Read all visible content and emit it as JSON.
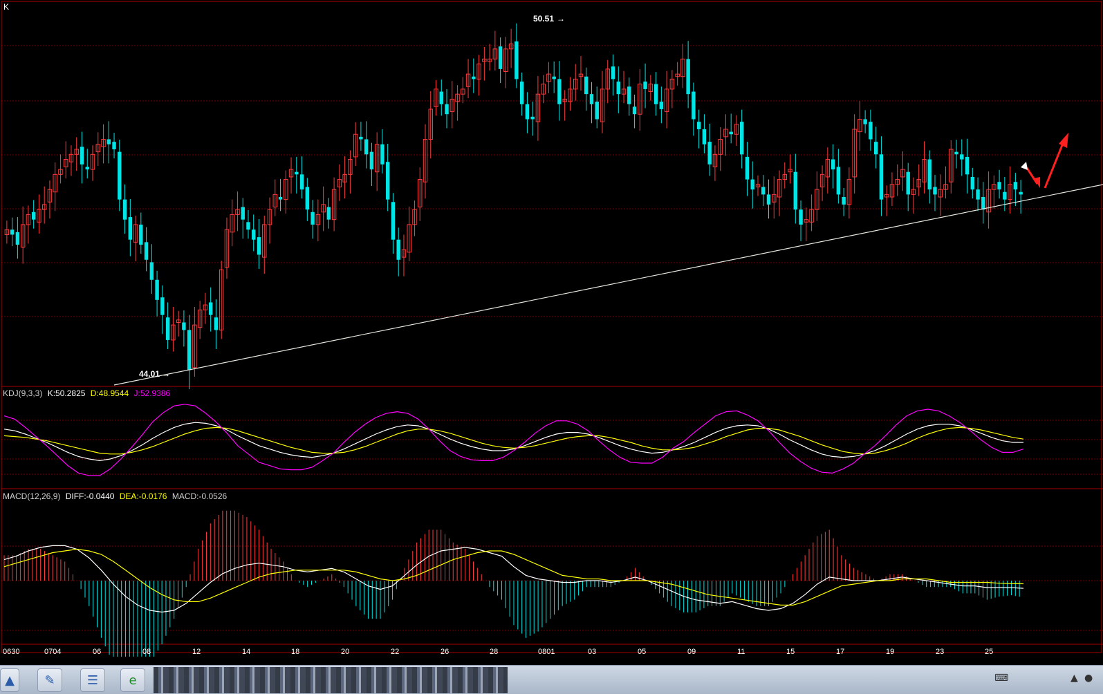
{
  "panel_label": "K",
  "kdj_label": {
    "name": "KDJ(9,3,3)",
    "k": "K:50.2825",
    "d": "D:48.9544",
    "j": "J:52.9386"
  },
  "macd_label": {
    "name": "MACD(12,26,9)",
    "diff": "DIFF:-0.0440",
    "dea": "DEA:-0.0176",
    "macd": "MACD:-0.0526"
  },
  "colors": {
    "up": "#ff3b3b",
    "down": "#00e5e5",
    "gridline": "#7a0000",
    "k_line": "#ffffff",
    "d_line": "#ffff00",
    "j_line": "#ff00ff",
    "panel_border": "#aa0000",
    "annotation_arrow": "#ff2020"
  },
  "chart_data": {
    "type": "candlestick",
    "annotations": {
      "high_label": "50.51",
      "low_label": "44.01",
      "trendline": "rising support line from 44.01 low",
      "arrows": "down then up (red)"
    },
    "ylim": [
      43.8,
      51.1
    ],
    "x_tick_labels": [
      "0630",
      "0704",
      "06",
      "08",
      "12",
      "14",
      "18",
      "20",
      "22",
      "26",
      "28",
      "0801",
      "03",
      "05",
      "09",
      "11",
      "15",
      "17",
      "19",
      "23",
      "25"
    ],
    "closes": [
      46.8,
      46.7,
      46.5,
      46.9,
      47.1,
      47.0,
      47.2,
      47.3,
      47.6,
      47.9,
      48.0,
      48.2,
      48.3,
      48.4,
      48.1,
      48.0,
      48.3,
      48.5,
      48.6,
      48.5,
      48.4,
      47.4,
      47.0,
      46.6,
      46.9,
      46.5,
      46.2,
      45.8,
      45.4,
      45.1,
      44.6,
      44.9,
      45.0,
      44.8,
      44.0,
      44.9,
      45.2,
      45.3,
      45.1,
      44.8,
      46.0,
      46.8,
      47.1,
      47.2,
      47.0,
      46.8,
      46.6,
      46.3,
      46.9,
      47.2,
      47.5,
      47.4,
      47.8,
      48.0,
      47.9,
      47.6,
      47.2,
      46.9,
      47.1,
      47.3,
      47.0,
      47.6,
      47.8,
      47.9,
      48.2,
      48.7,
      48.6,
      48.3,
      48.0,
      48.5,
      48.1,
      47.4,
      46.6,
      46.2,
      46.4,
      46.9,
      47.2,
      47.8,
      48.6,
      49.2,
      49.6,
      49.3,
      49.1,
      49.4,
      49.5,
      49.6,
      49.9,
      49.8,
      50.1,
      50.2,
      50.2,
      50.4,
      50.0,
      50.4,
      50.5,
      49.8,
      49.3,
      49.0,
      49.0,
      49.5,
      49.7,
      49.9,
      49.8,
      49.3,
      49.4,
      49.6,
      49.8,
      49.9,
      49.5,
      49.3,
      49.0,
      49.6,
      50.0,
      49.8,
      49.5,
      49.6,
      49.3,
      49.1,
      49.7,
      49.6,
      49.7,
      49.3,
      49.2,
      49.6,
      49.8,
      49.9,
      50.2,
      49.5,
      49.0,
      48.8,
      48.5,
      48.1,
      48.3,
      48.6,
      48.8,
      48.7,
      48.9,
      48.3,
      47.8,
      47.6,
      47.7,
      47.5,
      47.3,
      47.5,
      47.8,
      47.9,
      48.0,
      47.2,
      46.9,
      47.0,
      47.2,
      47.6,
      47.9,
      48.2,
      48.0,
      47.5,
      47.3,
      47.8,
      48.8,
      49.0,
      48.9,
      48.6,
      48.3,
      47.4,
      47.5,
      47.7,
      47.8,
      48.0,
      47.5,
      47.6,
      47.8,
      48.2,
      47.6,
      47.5,
      47.6,
      47.7,
      48.4,
      48.3,
      48.2,
      47.9,
      47.6,
      47.4,
      47.2,
      47.6,
      47.7,
      47.6,
      47.4,
      47.7,
      47.6,
      47.5
    ],
    "series": [
      {
        "name": "K",
        "values": [
          66,
          64,
          60,
          55,
          50,
          44,
          38,
          33,
          30,
          28,
          30,
          34,
          40,
          47,
          55,
          62,
          68,
          72,
          74,
          73,
          70,
          65,
          58,
          52,
          46,
          42,
          38,
          35,
          33,
          32,
          34,
          37,
          42,
          48,
          54,
          60,
          65,
          69,
          71,
          70,
          66,
          60,
          54,
          49,
          45,
          42,
          40,
          40,
          42,
          46,
          51,
          56,
          60,
          62,
          62,
          60,
          56,
          51,
          46,
          42,
          39,
          37,
          38,
          41,
          45,
          50,
          56,
          62,
          67,
          70,
          71,
          70,
          66,
          60,
          53,
          47,
          41,
          36,
          33,
          32,
          33,
          36,
          40,
          46,
          53,
          60,
          66,
          70,
          72,
          72,
          70,
          66,
          61,
          56,
          52,
          50,
          50
        ]
      },
      {
        "name": "D",
        "values": [
          58,
          57,
          56,
          54,
          52,
          49,
          46,
          43,
          40,
          37,
          36,
          36,
          38,
          41,
          45,
          50,
          55,
          60,
          64,
          67,
          68,
          67,
          64,
          60,
          56,
          52,
          48,
          44,
          41,
          38,
          37,
          37,
          38,
          41,
          45,
          50,
          55,
          60,
          64,
          66,
          66,
          64,
          61,
          57,
          53,
          49,
          46,
          44,
          43,
          44,
          46,
          49,
          52,
          55,
          57,
          58,
          58,
          56,
          53,
          50,
          46,
          43,
          41,
          41,
          42,
          44,
          48,
          52,
          57,
          61,
          65,
          67,
          67,
          65,
          61,
          57,
          52,
          47,
          43,
          39,
          37,
          36,
          37,
          40,
          44,
          49,
          55,
          60,
          64,
          67,
          68,
          67,
          65,
          62,
          59,
          56,
          54
        ]
      },
      {
        "name": "J",
        "values": [
          82,
          78,
          68,
          57,
          46,
          34,
          22,
          13,
          10,
          10,
          18,
          30,
          44,
          59,
          75,
          86,
          94,
          96,
          94,
          85,
          74,
          61,
          46,
          36,
          26,
          22,
          18,
          17,
          17,
          20,
          28,
          37,
          50,
          62,
          72,
          80,
          85,
          87,
          85,
          78,
          66,
          52,
          40,
          33,
          29,
          28,
          28,
          32,
          40,
          50,
          61,
          70,
          76,
          76,
          72,
          64,
          52,
          41,
          32,
          26,
          25,
          25,
          32,
          43,
          51,
          62,
          72,
          82,
          87,
          88,
          83,
          76,
          64,
          50,
          37,
          27,
          19,
          14,
          13,
          18,
          25,
          36,
          46,
          58,
          71,
          82,
          88,
          90,
          88,
          82,
          74,
          64,
          53,
          44,
          38,
          38,
          42
        ]
      },
      {
        "name": "DIFF",
        "values": [
          0.12,
          0.14,
          0.17,
          0.19,
          0.2,
          0.2,
          0.18,
          0.13,
          0.06,
          -0.02,
          -0.09,
          -0.14,
          -0.17,
          -0.18,
          -0.17,
          -0.13,
          -0.07,
          -0.01,
          0.04,
          0.07,
          0.09,
          0.1,
          0.09,
          0.08,
          0.06,
          0.05,
          0.06,
          0.07,
          0.05,
          0.01,
          -0.03,
          -0.05,
          -0.03,
          0.03,
          0.09,
          0.14,
          0.17,
          0.18,
          0.19,
          0.18,
          0.16,
          0.14,
          0.08,
          0.03,
          0.01,
          0.0,
          -0.01,
          -0.01,
          0.0,
          0.0,
          -0.01,
          0.0,
          0.02,
          0.0,
          -0.03,
          -0.06,
          -0.09,
          -0.11,
          -0.12,
          -0.13,
          -0.12,
          -0.14,
          -0.16,
          -0.17,
          -0.16,
          -0.13,
          -0.08,
          -0.02,
          0.02,
          0.01,
          0.0,
          0.0,
          0.0,
          0.01,
          0.02,
          0.01,
          0.0,
          -0.01,
          -0.02,
          -0.03,
          -0.03,
          -0.04,
          -0.04,
          -0.04,
          -0.044
        ]
      },
      {
        "name": "DEA",
        "values": [
          0.08,
          0.1,
          0.12,
          0.14,
          0.16,
          0.17,
          0.18,
          0.17,
          0.15,
          0.11,
          0.06,
          0.01,
          -0.04,
          -0.08,
          -0.11,
          -0.12,
          -0.12,
          -0.1,
          -0.07,
          -0.04,
          -0.01,
          0.02,
          0.04,
          0.05,
          0.06,
          0.06,
          0.06,
          0.06,
          0.06,
          0.05,
          0.03,
          0.01,
          0.0,
          0.01,
          0.03,
          0.06,
          0.09,
          0.12,
          0.14,
          0.16,
          0.17,
          0.17,
          0.15,
          0.12,
          0.09,
          0.06,
          0.03,
          0.02,
          0.01,
          0.01,
          0.0,
          0.0,
          0.0,
          0.0,
          -0.01,
          -0.02,
          -0.04,
          -0.06,
          -0.08,
          -0.09,
          -0.1,
          -0.11,
          -0.12,
          -0.13,
          -0.14,
          -0.14,
          -0.12,
          -0.09,
          -0.06,
          -0.03,
          -0.02,
          -0.01,
          0.0,
          0.0,
          0.01,
          0.01,
          0.01,
          0.0,
          -0.01,
          -0.01,
          -0.01,
          -0.01,
          -0.015,
          -0.017,
          -0.0176
        ]
      }
    ]
  },
  "taskbar": {
    "icons": [
      "start-icon",
      "edit-icon",
      "notes-icon",
      "ie-icon"
    ],
    "tray_icons": [
      "keyboard-icon",
      "arrow-icon",
      "qq-icon"
    ]
  }
}
